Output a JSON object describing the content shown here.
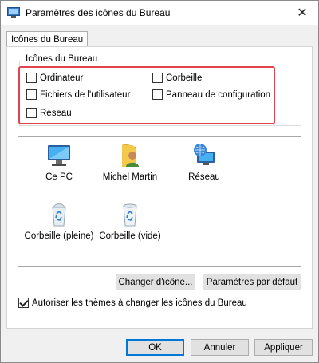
{
  "window": {
    "title": "Paramètres des icônes du Bureau",
    "close_glyph": "✕"
  },
  "tab": {
    "label": "Icônes du Bureau"
  },
  "group": {
    "legend": "Icônes du Bureau",
    "checkboxes": [
      {
        "label": "Ordinateur",
        "checked": false
      },
      {
        "label": "Corbeille",
        "checked": false
      },
      {
        "label": "Fichiers de l'utilisateur",
        "checked": false
      },
      {
        "label": "Panneau de configuration",
        "checked": false
      },
      {
        "label": "Réseau",
        "checked": false
      }
    ],
    "highlight_color": "#e0464f"
  },
  "icons": [
    {
      "label": "Ce PC",
      "icon": "computer-icon"
    },
    {
      "label": "Michel Martin",
      "icon": "user-folder-icon"
    },
    {
      "label": "Réseau",
      "icon": "network-icon"
    },
    {
      "label": "Corbeille (pleine)",
      "icon": "recycle-bin-full-icon"
    },
    {
      "label": "Corbeille (vide)",
      "icon": "recycle-bin-empty-icon"
    }
  ],
  "buttons": {
    "change_icon": "Changer d'icône...",
    "restore_default": "Paramètres par défaut",
    "ok": "OK",
    "cancel": "Annuler",
    "apply": "Appliquer"
  },
  "themes_checkbox": {
    "label": "Autoriser les thèmes à changer les icônes du Bureau",
    "checked": true
  },
  "colors": {
    "accent": "#0078d7",
    "panel_bg": "#f0f0f0"
  }
}
